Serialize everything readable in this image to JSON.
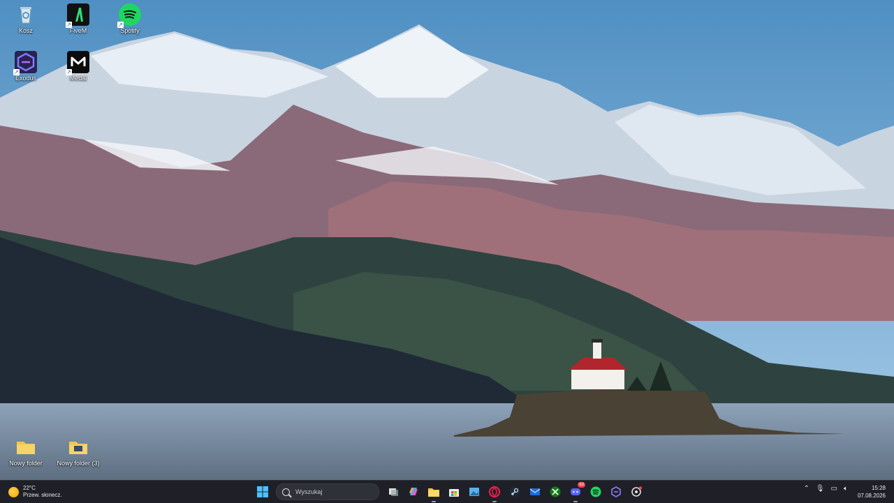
{
  "desktop": {
    "icons": [
      {
        "label": "Kosz",
        "icon": "recycle-bin-icon"
      },
      {
        "label": "FiveM",
        "icon": "fivem-icon"
      },
      {
        "label": "Spotify",
        "icon": "spotify-icon"
      },
      {
        "label": "Exodus",
        "icon": "exodus-icon"
      },
      {
        "label": "Medal",
        "icon": "medal-icon"
      },
      {
        "label": "Nowy folder",
        "icon": "folder-icon"
      },
      {
        "label": "Nowy folder (3)",
        "icon": "folder-icon"
      }
    ]
  },
  "taskbar": {
    "weather": {
      "temp": "22°C",
      "desc": "Przew. słonecz."
    },
    "search": {
      "placeholder": "Wyszukaj"
    },
    "apps": [
      "start-icon",
      "task-view-icon",
      "copilot-icon",
      "file-explorer-icon",
      "microsoft-store-icon",
      "photos-icon",
      "opera-gx-icon",
      "steam-icon",
      "mail-icon",
      "xbox-icon",
      "discord-icon",
      "spotify-icon",
      "exodus-icon",
      "chatgpt-icon"
    ],
    "discord_badge": "63",
    "tray": [
      "chevron-up-icon",
      "microphone-icon",
      "display-icon",
      "speaker-icon"
    ],
    "clock": {
      "time": "15:28",
      "date": "07.08.2026"
    }
  },
  "colors": {
    "taskbar": "#1f2027",
    "accent": "#0078d4"
  }
}
